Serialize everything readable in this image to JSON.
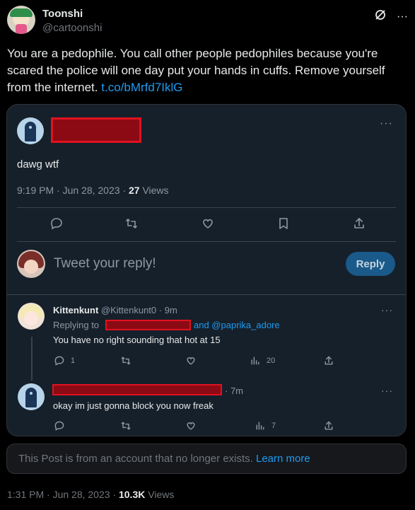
{
  "author": {
    "display_name": "Toonshi",
    "handle": "@cartoonshi"
  },
  "tweet": {
    "text": "You are a pedophile. You call other people pedophiles because you're scared the police will one day put your hands in cuffs. Remove yourself from the internet.",
    "link": "t.co/bMrfd7IklG"
  },
  "quote": {
    "text": "dawg wtf",
    "time": "9:19 PM · Jun 28, 2023 · ",
    "views_count": "27",
    "views_label": " Views"
  },
  "reply_box": {
    "placeholder": "Tweet your reply!",
    "button": "Reply"
  },
  "replies": [
    {
      "name": "Kittenkunt",
      "handle": "@Kittenkunt0",
      "time": "· 9m",
      "replying_prefix": "Replying to",
      "replying_suffix": "and @paprika_adore",
      "text": "You have no right sounding that hot at 15",
      "reply_count": "1",
      "view_count": "20"
    },
    {
      "time": "· 7m",
      "text": "okay im just gonna block you now freak",
      "view_count": "7"
    }
  ],
  "notice": {
    "text": "This Post is from an account that no longer exists.",
    "link": "Learn more"
  },
  "footer": {
    "time": "1:31 PM · Jun 28, 2023 · ",
    "views_count": "10.3K",
    "views_label": " Views"
  },
  "colors": {
    "accent": "#1d9bf0",
    "redaction": "#e0121f",
    "card_bg": "#16202a"
  },
  "more_glyph": "···"
}
